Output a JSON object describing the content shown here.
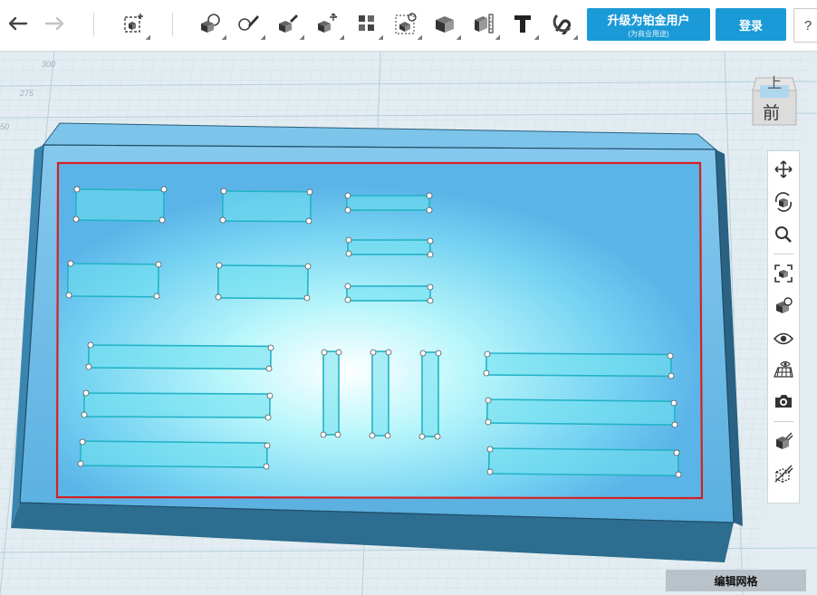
{
  "toolbar": {
    "undo_icon": "undo-arrow-icon",
    "redo_icon": "redo-arrow-icon",
    "tools": [
      "new-shape-icon",
      "group-icon",
      "paint-icon",
      "adjust-icon",
      "transform-icon",
      "multiply-icon",
      "align-icon",
      "solid-icon",
      "ruler-icon",
      "text-icon",
      "magnet-icon"
    ]
  },
  "upgrade": {
    "label": "升级为铂金用户",
    "sublabel": "(为商业用途)"
  },
  "login": {
    "label": "登录"
  },
  "help": {
    "label": "?"
  },
  "viewcube": {
    "top_label": "上",
    "front_label": "前"
  },
  "ruler": {
    "labels": [
      "300",
      "275",
      "50"
    ]
  },
  "right_toolbar": {
    "buttons": [
      "pan-icon",
      "orbit-icon",
      "zoom-icon",
      "fit-view-icon",
      "home-view-icon",
      "visibility-eye-icon",
      "grid-view-icon",
      "camera-icon",
      "solid-mode-icon",
      "wireframe-mode-icon"
    ]
  },
  "edit_grid": {
    "label": "编辑网格"
  },
  "colors": {
    "toolbar_accent": "#1a9ad6",
    "box_top": "#6bbbe6",
    "box_side": "#2c6a8c",
    "inner_highlight": "#d62020",
    "hole_stroke": "#24b3c7"
  }
}
